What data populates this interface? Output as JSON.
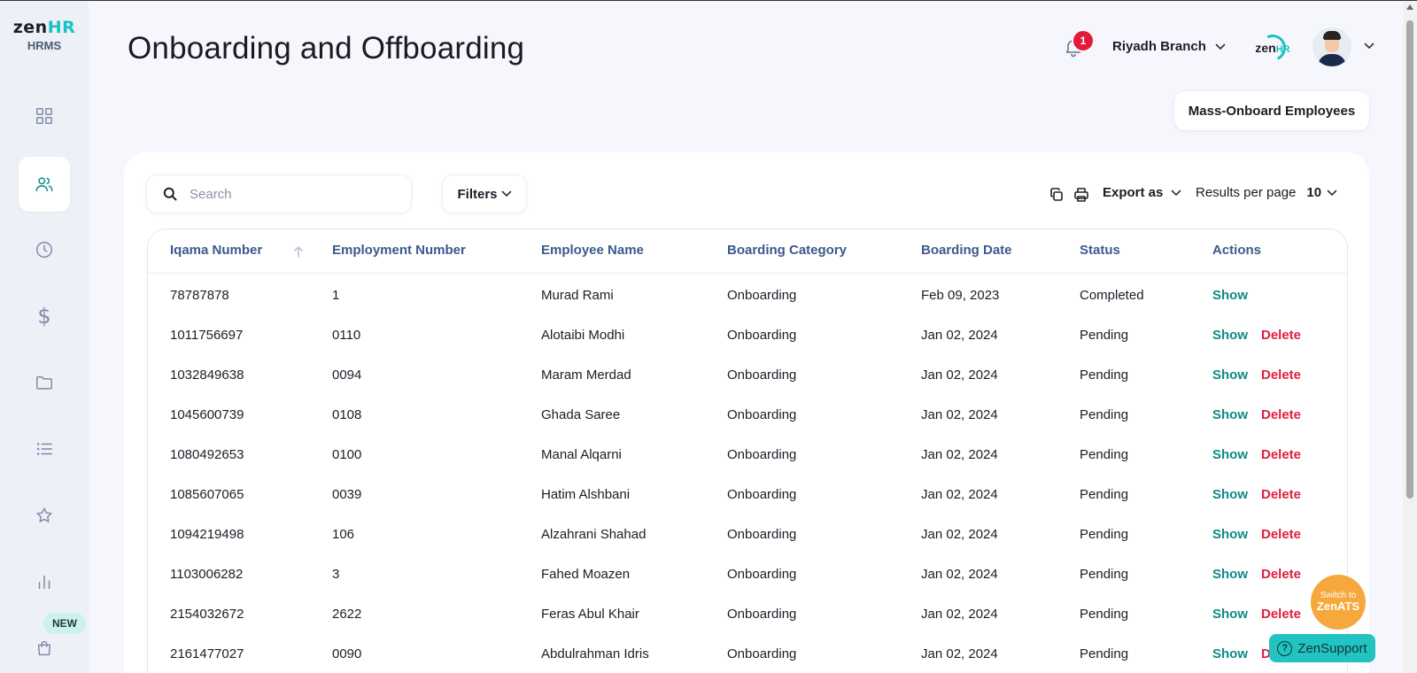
{
  "sidebar": {
    "logo": {
      "zen": "zen",
      "hr": "HR",
      "sub": "HRMS"
    },
    "items": [
      {
        "icon": "dashboard-icon",
        "active": false
      },
      {
        "icon": "users-icon",
        "active": true
      },
      {
        "icon": "clock-icon",
        "active": false
      },
      {
        "icon": "dollar-icon",
        "active": false,
        "glyph": "$"
      },
      {
        "icon": "folder-icon",
        "active": false
      },
      {
        "icon": "list-icon",
        "active": false
      },
      {
        "icon": "star-icon",
        "active": false
      },
      {
        "icon": "bar-chart-icon",
        "active": false
      },
      {
        "icon": "shopping-bag-icon",
        "active": false
      }
    ],
    "new_badge": "NEW"
  },
  "header": {
    "title": "Onboarding and Offboarding",
    "notification_count": "1",
    "branch": "Riyadh Branch",
    "company_logo_text": {
      "zen": "zen",
      "hr": "HR"
    }
  },
  "actions": {
    "mass_onboard": "Mass-Onboard Employees"
  },
  "toolbar": {
    "search_placeholder": "Search",
    "filters_label": "Filters",
    "export_label": "Export as",
    "results_per_page_label": "Results per page",
    "results_per_page_value": "10"
  },
  "table": {
    "columns": [
      "Iqama Number",
      "Employment Number",
      "Employee Name",
      "Boarding Category",
      "Boarding Date",
      "Status",
      "Actions"
    ],
    "rows": [
      {
        "iqama": "78787878",
        "employment": "1",
        "name": "Murad Rami",
        "category": "Onboarding",
        "date": "Feb 09, 2023",
        "status": "Completed",
        "show": "Show",
        "delete": ""
      },
      {
        "iqama": "1011756697",
        "employment": "0110",
        "name": "Alotaibi Modhi",
        "category": "Onboarding",
        "date": "Jan 02, 2024",
        "status": "Pending",
        "show": "Show",
        "delete": "Delete"
      },
      {
        "iqama": "1032849638",
        "employment": "0094",
        "name": "Maram Merdad",
        "category": "Onboarding",
        "date": "Jan 02, 2024",
        "status": "Pending",
        "show": "Show",
        "delete": "Delete"
      },
      {
        "iqama": "1045600739",
        "employment": "0108",
        "name": "Ghada Saree",
        "category": "Onboarding",
        "date": "Jan 02, 2024",
        "status": "Pending",
        "show": "Show",
        "delete": "Delete"
      },
      {
        "iqama": "1080492653",
        "employment": "0100",
        "name": "Manal Alqarni",
        "category": "Onboarding",
        "date": "Jan 02, 2024",
        "status": "Pending",
        "show": "Show",
        "delete": "Delete"
      },
      {
        "iqama": "1085607065",
        "employment": "0039",
        "name": "Hatim Alshbani",
        "category": "Onboarding",
        "date": "Jan 02, 2024",
        "status": "Pending",
        "show": "Show",
        "delete": "Delete"
      },
      {
        "iqama": "1094219498",
        "employment": "106",
        "name": "Alzahrani Shahad",
        "category": "Onboarding",
        "date": "Jan 02, 2024",
        "status": "Pending",
        "show": "Show",
        "delete": "Delete"
      },
      {
        "iqama": "1103006282",
        "employment": "3",
        "name": "Fahed Moazen",
        "category": "Onboarding",
        "date": "Jan 02, 2024",
        "status": "Pending",
        "show": "Show",
        "delete": "Delete"
      },
      {
        "iqama": "2154032672",
        "employment": "2622",
        "name": "Feras Abul Khair",
        "category": "Onboarding",
        "date": "Jan 02, 2024",
        "status": "Pending",
        "show": "Show",
        "delete": "Delete"
      },
      {
        "iqama": "2161477027",
        "employment": "0090",
        "name": "Abdulrahman Idris",
        "category": "Onboarding",
        "date": "Jan 02, 2024",
        "status": "Pending",
        "show": "Show",
        "delete": "Delete"
      }
    ]
  },
  "floating": {
    "ats_small": "Switch to",
    "ats_big": "ZenATS",
    "support": "ZenSupport"
  },
  "colors": {
    "accent_teal": "#0d8a85",
    "danger_red": "#e01e3c",
    "header_blue": "#3b5a8c",
    "ats_orange": "#f6a83c",
    "support_teal": "#21c4c0"
  }
}
